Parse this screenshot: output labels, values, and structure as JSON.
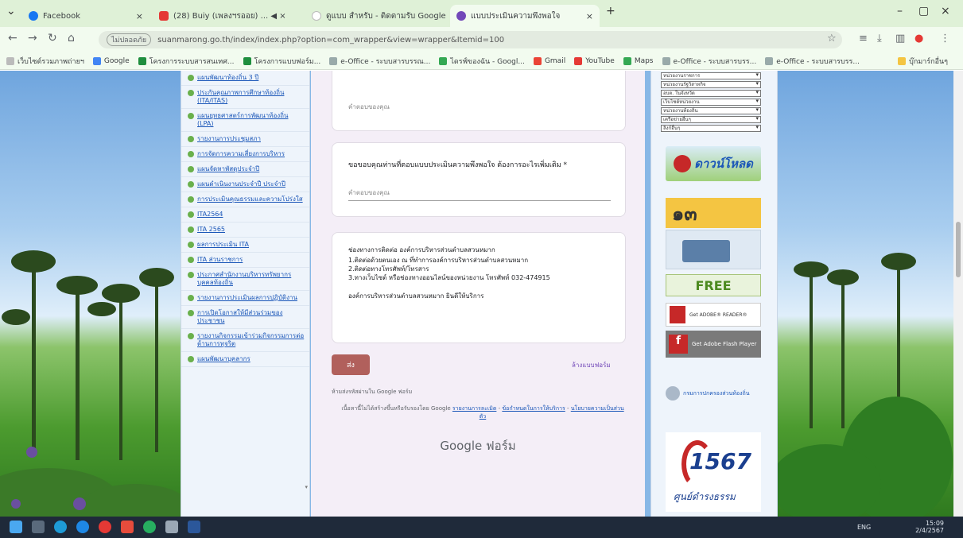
{
  "browser": {
    "tabs": [
      {
        "label": "Facebook",
        "color": "#1877f2"
      },
      {
        "label": "(28) Buiy (เพลงฯรออย) ... ◀ ×",
        "color": "#e53935"
      },
      {
        "label": "ดูแบบ สำหรับ - ติดตามรับ Google",
        "color": "#fff"
      },
      {
        "label": "แบบประเมินความพึงพอใจ",
        "color": "#7248b9"
      }
    ],
    "new_tab": "+",
    "url_secure": "ไม่ปลอดภัย",
    "url": "suanmarong.go.th/index/index.php?option=com_wrapper&view=wrapper&Itemid=100"
  },
  "bookmarks": [
    {
      "label": "เว็บไซต์รวมภาพถ่ายฯ",
      "color": "#bbb"
    },
    {
      "label": "Google",
      "color": "#4285f4"
    },
    {
      "label": "โครงการระบบสารสนเทศ...",
      "color": "#1e8e3e"
    },
    {
      "label": "โครงการแบบฟอร์ม...",
      "color": "#1e8e3e"
    },
    {
      "label": "e-Office - ระบบสารบรรณ...",
      "color": "#9aa"
    },
    {
      "label": "ไดรฟ์ของฉัน - Googl...",
      "color": "#34a853"
    },
    {
      "label": "Gmail",
      "color": "#ea4335"
    },
    {
      "label": "YouTube",
      "color": "#e53935"
    },
    {
      "label": "Maps",
      "color": "#34a853"
    },
    {
      "label": "e-Office - ระบบสารบรร...",
      "color": "#9aa"
    },
    {
      "label": "e-Office - ระบบสารบรร...",
      "color": "#9aa"
    }
  ],
  "bookmarks_other": "บุ๊กมาร์กอื่นๆ",
  "leftnav": [
    "แผนพัฒนาท้องถิ่น 3 ปี",
    "ประกันคุณภาพการศึกษาท้องถิ่น (ITA/ITAS)",
    "แผนยุทธศาสตร์การพัฒนาท้องถิ่น (LPA)",
    "รายงานการประชุมสภา",
    "การจัดการความเสี่ยงการบริหาร",
    "แผนจัดหาพัสดุประจำปี",
    "แผนดำเนินงานประจำปี ประจำปี",
    "การประเมินคุณธรรมและความโปร่งใส",
    "ITA2564",
    "ITA 2565",
    "ผลการประเมิน ITA",
    "ITA ส่วนราชการ",
    "ประกาศสำนักงานบริหารทรัพยากรบุคคลท้องถิ่น",
    "รายงานการประเมินผลการปฏิบัติงาน",
    "การเปิดโอกาสให้มีส่วนร่วมของประชาชน",
    "รายงานกิจกรรมเข้าร่วมกิจกรรมการต่อต้านการทุจริต",
    "แผนพัฒนาบุคลากร"
  ],
  "form": {
    "q_prev_answer": "คำตอบของคุณ",
    "q_title": "ขอขอบคุณท่านที่ตอบแบบประเมินความพึงพอใจ ต้องการอะไรเพิ่มเติม *",
    "q_answer_placeholder": "คำตอบของคุณ",
    "info_title": "ช่องทางการติดต่อ องค์การบริหารส่วนตำบลสวนหมาก",
    "info_lines": [
      "1.ติดต่อด้วยตนเอง ณ ที่ทำการองค์การบริหารส่วนตำบลสวนหมาก",
      "2.ติดต่อทางโทรศัพท์/โทรสาร",
      "3.ทางเว็บไซต์ หรือช่องทางออนไลน์ของหน่วยงาน โทรศัพท์ 032-474915",
      "องค์การบริหารส่วนตำบลสวนหมาก ยินดีให้บริการ"
    ],
    "submit_label": "ส่ง",
    "clear_label": "ล้างแบบฟอร์ม",
    "footnote1": "ห้ามส่งรหัสผ่านใน Google ฟอร์ม",
    "footnote2_prefix": "เนื้อหานี้ไม่ได้สร้างขึ้นหรือรับรองโดย Google",
    "footnote2_link1": "รายงานการละเมิด",
    "footnote2_link2": "ข้อกำหนดในการให้บริการ",
    "footnote2_link3": "นโยบายความเป็นส่วนตัว",
    "brand": "Google ฟอร์ม"
  },
  "rightcol": {
    "selects": [
      "หน่วยงานราชการ",
      "หน่วยงานรัฐวิสาหกิจ",
      "อบต. ในจังหวัด",
      "เว็บไซต์หน่วยงาน",
      "หน่วยงานท้องถิ่น",
      "เครือข่ายอื่นๆ",
      "ลิงก์อื่นๆ"
    ],
    "download_banner": "ดาวน์โหลด",
    "banner_13": "๑๓",
    "free_label": "FREE",
    "adobe_reader": "Get ADOBE® READER®",
    "flash_player": "Get Adobe Flash Player",
    "doc_agency": "กรมการปกครองส่วนท้องถิ่น",
    "hotline": "1567",
    "hotline_sub": "ศูนย์ดำรงธรรม"
  },
  "tray": {
    "lang": "ENG",
    "time": "15:09",
    "date": "2/4/2567"
  },
  "colors": {
    "form_bg": "#f4eef7",
    "accent": "#b1605c",
    "nav_link": "#1a56b8"
  }
}
